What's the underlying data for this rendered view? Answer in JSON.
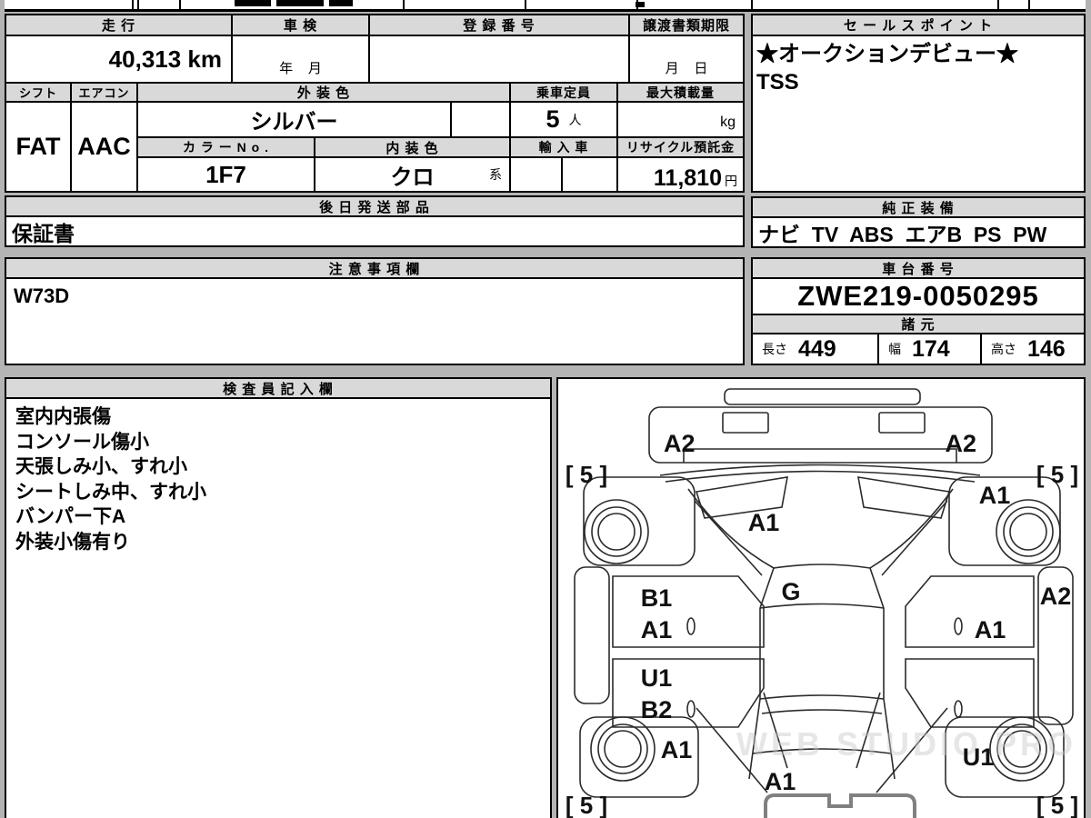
{
  "top_table": {
    "headers": {
      "mileage": "走 行",
      "inspection": "車 検",
      "registration": "登 録 番 号",
      "transfer_deadline": "譲渡書類期限",
      "shift": "シフト",
      "aircon": "エアコン",
      "exterior_color": "外 装 色",
      "capacity": "乗車定員",
      "max_load": "最大積載量",
      "color_no": "カ ラ ー N o .",
      "interior_color": "内 装 色",
      "import_car": "輸 入 車",
      "recycle_deposit": "リサイクル預託金"
    },
    "values": {
      "mileage": "40,313 km",
      "inspection": "年    月",
      "transfer_deadline": "月    日",
      "shift": "FAT",
      "aircon": "AAC",
      "exterior_color": "シルバー",
      "capacity": "5",
      "capacity_unit": "人",
      "max_load_unit": "kg",
      "color_no": "1F7",
      "interior_color": "クロ",
      "interior_color_suffix": "系",
      "recycle_deposit": "11,810",
      "recycle_unit": "円"
    }
  },
  "sales_point": {
    "title": "セ ー ル ス ポ イ ン ト",
    "lines": [
      "★オークションデビュー★",
      "TSS"
    ]
  },
  "shipped_later": {
    "title": "後 日 発 送 部 品",
    "value": "保証書"
  },
  "genuine_equipment": {
    "title": "純 正 装 備",
    "value": "ナビ  TV  ABS  エアB  PS  PW"
  },
  "notes": {
    "title": "注 意 事 項 欄",
    "value": "W73D"
  },
  "chassis_number": {
    "title": "車 台 番 号",
    "value": "ZWE219-0050295"
  },
  "specs": {
    "title": "諸 元",
    "length_label": "長さ",
    "length_value": "449",
    "width_label": "幅",
    "width_value": "174",
    "height_label": "高さ",
    "height_value": "146"
  },
  "inspector_notes": {
    "title": "検 査 員 記 入 欄",
    "lines": [
      "室内内張傷",
      "コンソール傷小",
      "天張しみ小、すれ小",
      "シートしみ中、すれ小",
      "バンパー下A",
      "外装小傷有り"
    ]
  },
  "diagram": {
    "watermark": "WEB STUDIO PRO",
    "labels": {
      "front_bumper_left": "A2",
      "front_bumper_right": "A2",
      "hood": "A1",
      "windshield": "G",
      "front_fender_right": "A1",
      "door_front_left_top": "B1",
      "door_front_left_bottom": "A1",
      "door_rear_left_top": "U1",
      "door_rear_left_bottom": "B2",
      "door_front_right": "A1",
      "sill_right": "A2",
      "rear_fender_left": "A1",
      "rear_quarter_right": "U1",
      "rear_hatch": "A1",
      "corner_front_left": "[ 5 ]",
      "corner_front_right": "[ 5 ]",
      "corner_rear_left": "[ 5 ]",
      "corner_rear_right": "[ 5 ]"
    }
  }
}
